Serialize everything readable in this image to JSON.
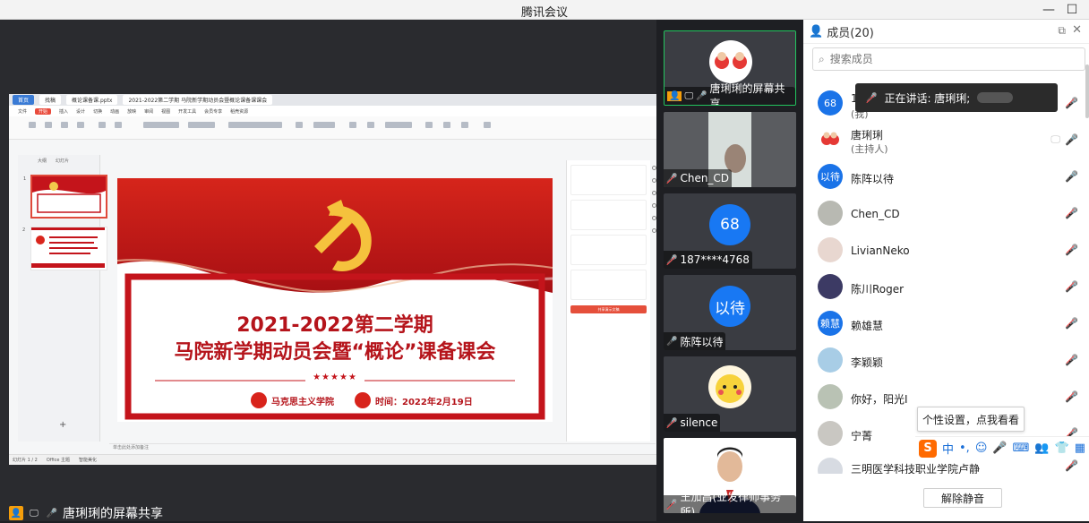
{
  "window": {
    "title": "腾讯会议",
    "minimize": "—",
    "maximize": "☐"
  },
  "share": {
    "status_label": "唐琍琍的屏幕共享",
    "document": {
      "tabs": [
        "首页",
        "找稿",
        "概论课备课.pptx",
        "2021-2022第二学期 马院新学期动员会暨概论课备课课会"
      ],
      "menu": [
        "文件",
        "开始",
        "插入",
        "设计",
        "切换",
        "动画",
        "放映",
        "审阅",
        "视图",
        "开发工具",
        "会员专享",
        "稻壳资源"
      ],
      "thumbs_header": [
        "大纲",
        "幻灯片"
      ],
      "slide": {
        "title_line1": "2021-2022第二学期",
        "title_line2": "马院新学期动员会暨“概论”课备课会",
        "org": "马克思主义学院",
        "time": "时间：2022年2月19日",
        "stars": "★★★★★"
      },
      "side_panel_button": "共享演示文稿",
      "notes_placeholder": "单击此处添加备注",
      "status_left": "幻灯片 1 / 2",
      "status_theme": "Office 主题",
      "status_zoom": "智能美化"
    }
  },
  "video_tiles": [
    {
      "name": "唐琍琍的屏幕共享",
      "kind": "image",
      "active": true
    },
    {
      "name": "Chen_CD",
      "kind": "image"
    },
    {
      "name": "187****4768",
      "kind": "initials",
      "initials": "68"
    },
    {
      "name": "陈阵以待",
      "kind": "initials",
      "initials": "以待"
    },
    {
      "name": "silence",
      "kind": "image"
    },
    {
      "name": "王加昌(业发律师事务所)",
      "kind": "image"
    }
  ],
  "members": {
    "header": "成员(20)",
    "search_placeholder": "搜索成员",
    "speaking_prefix": "正在讲话: 唐琍琍;",
    "list": [
      {
        "avatar": "68",
        "name": "1",
        "role": "(我)"
      },
      {
        "avatar": "",
        "name": "唐琍琍",
        "role": "(主持人)"
      },
      {
        "avatar": "以待",
        "name": "陈阵以待",
        "role": ""
      },
      {
        "avatar": "",
        "name": "Chen_CD",
        "role": ""
      },
      {
        "avatar": "",
        "name": "LivianNeko",
        "role": ""
      },
      {
        "avatar": "",
        "name": "陈川Roger",
        "role": ""
      },
      {
        "avatar": "赖慧",
        "name": "赖雄慧",
        "role": ""
      },
      {
        "avatar": "",
        "name": "李颖颖",
        "role": ""
      },
      {
        "avatar": "",
        "name": "你好，阳光I",
        "role": ""
      },
      {
        "avatar": "",
        "name": "宁菁",
        "role": ""
      },
      {
        "avatar": "",
        "name": "三明医学科技职业学院卢静",
        "role": ""
      }
    ],
    "tooltip": "个性设置，点我看看",
    "ime": {
      "logo": "S",
      "lang": "中",
      "punct": "•,",
      "face": "☺",
      "mic": "🎤",
      "kbd": "⌨",
      "people": "👥",
      "shirt": "👕",
      "grid": "▦"
    },
    "unmute_button": "解除静音"
  },
  "colors": {
    "party_red": "#c4141b",
    "accent_blue": "#1878f3",
    "active_green": "#22c55e"
  }
}
